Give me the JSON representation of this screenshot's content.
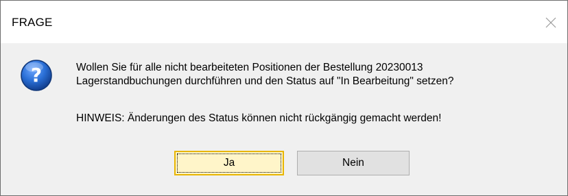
{
  "dialog": {
    "title": "FRAGE",
    "close_icon": "close-icon",
    "icon": "question-icon",
    "message_line1": "Wollen Sie für alle nicht bearbeiteten Positionen der Bestellung 20230013",
    "message_line2": "Lagerstandbuchungen durchführen und den Status auf \"In Bearbeitung\" setzen?",
    "hint": "HINWEIS: Änderungen des Status können nicht rückgängig gemacht werden!",
    "buttons": {
      "yes_label": "Ja",
      "no_label": "Nein"
    }
  },
  "colors": {
    "accent_yes_border": "#e8b500",
    "accent_yes_fill": "#fff5c9",
    "icon_blue": "#1f5fbf"
  }
}
